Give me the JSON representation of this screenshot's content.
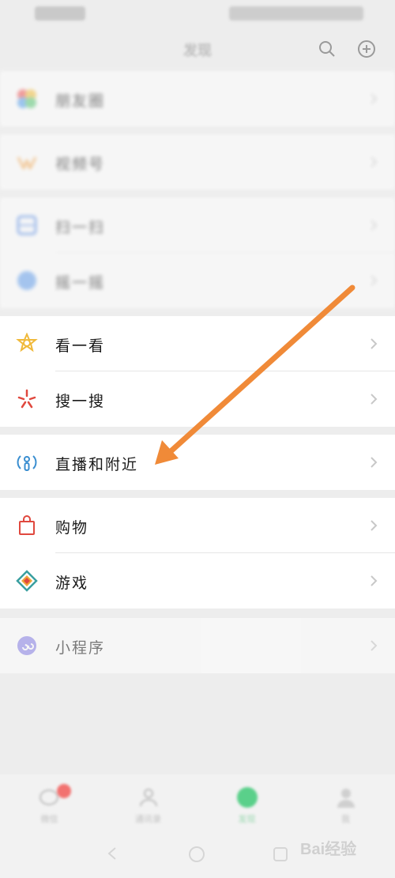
{
  "header": {
    "title": "发现"
  },
  "groups": {
    "g1": [
      {
        "label": "朋友圈",
        "icon": "moments-icon"
      }
    ],
    "g2": [
      {
        "label": "视频号",
        "icon": "channels-icon"
      }
    ],
    "g3": [
      {
        "label": "扫一扫",
        "icon": "scan-icon"
      },
      {
        "label": "摇一摇",
        "icon": "shake-icon"
      }
    ],
    "g4": [
      {
        "label": "看一看",
        "icon": "top-stories-icon"
      },
      {
        "label": "搜一搜",
        "icon": "search-icon"
      }
    ],
    "g5": [
      {
        "label": "直播和附近",
        "icon": "live-nearby-icon"
      }
    ],
    "g6": [
      {
        "label": "购物",
        "icon": "shopping-bag-icon"
      },
      {
        "label": "游戏",
        "icon": "games-icon"
      }
    ],
    "g7": [
      {
        "label": "小程序",
        "icon": "mini-programs-icon"
      }
    ]
  },
  "tabbar": {
    "tabs": [
      {
        "label": "微信"
      },
      {
        "label": "通讯录"
      },
      {
        "label": "发现"
      },
      {
        "label": "我"
      }
    ]
  },
  "watermark": "Bai经验",
  "colors": {
    "arrow": "#f08a38",
    "accent": "#07c160",
    "badge": "#f25350"
  }
}
